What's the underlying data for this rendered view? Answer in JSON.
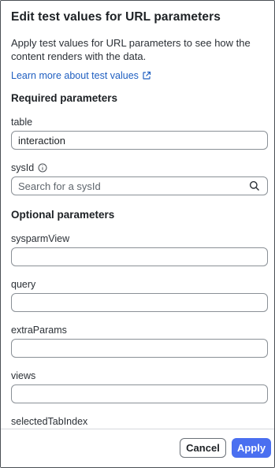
{
  "dialog": {
    "title": "Edit test values for URL parameters",
    "description": "Apply test values for URL parameters to see how the content renders with the data.",
    "learn_more_label": "Learn more about test values"
  },
  "required_section": {
    "title": "Required parameters",
    "fields": {
      "table": {
        "label": "table",
        "value": "interaction"
      },
      "sysid": {
        "label": "sysId",
        "placeholder": "Search for a sysId"
      }
    }
  },
  "optional_section": {
    "title": "Optional parameters",
    "fields": {
      "sysparm_view": {
        "label": "sysparmView",
        "value": ""
      },
      "query": {
        "label": "query",
        "value": ""
      },
      "extra_params": {
        "label": "extraParams",
        "value": ""
      },
      "views": {
        "label": "views",
        "value": ""
      },
      "selected_tab_index": {
        "label": "selectedTabIndex",
        "value": ""
      }
    }
  },
  "footer": {
    "cancel_label": "Cancel",
    "apply_label": "Apply"
  },
  "colors": {
    "accent": "#4a6ff0",
    "link": "#1f5fc1",
    "border": "#8a9096"
  },
  "icons": {
    "external_link": "external-link-icon",
    "info": "info-icon",
    "search": "search-icon"
  }
}
